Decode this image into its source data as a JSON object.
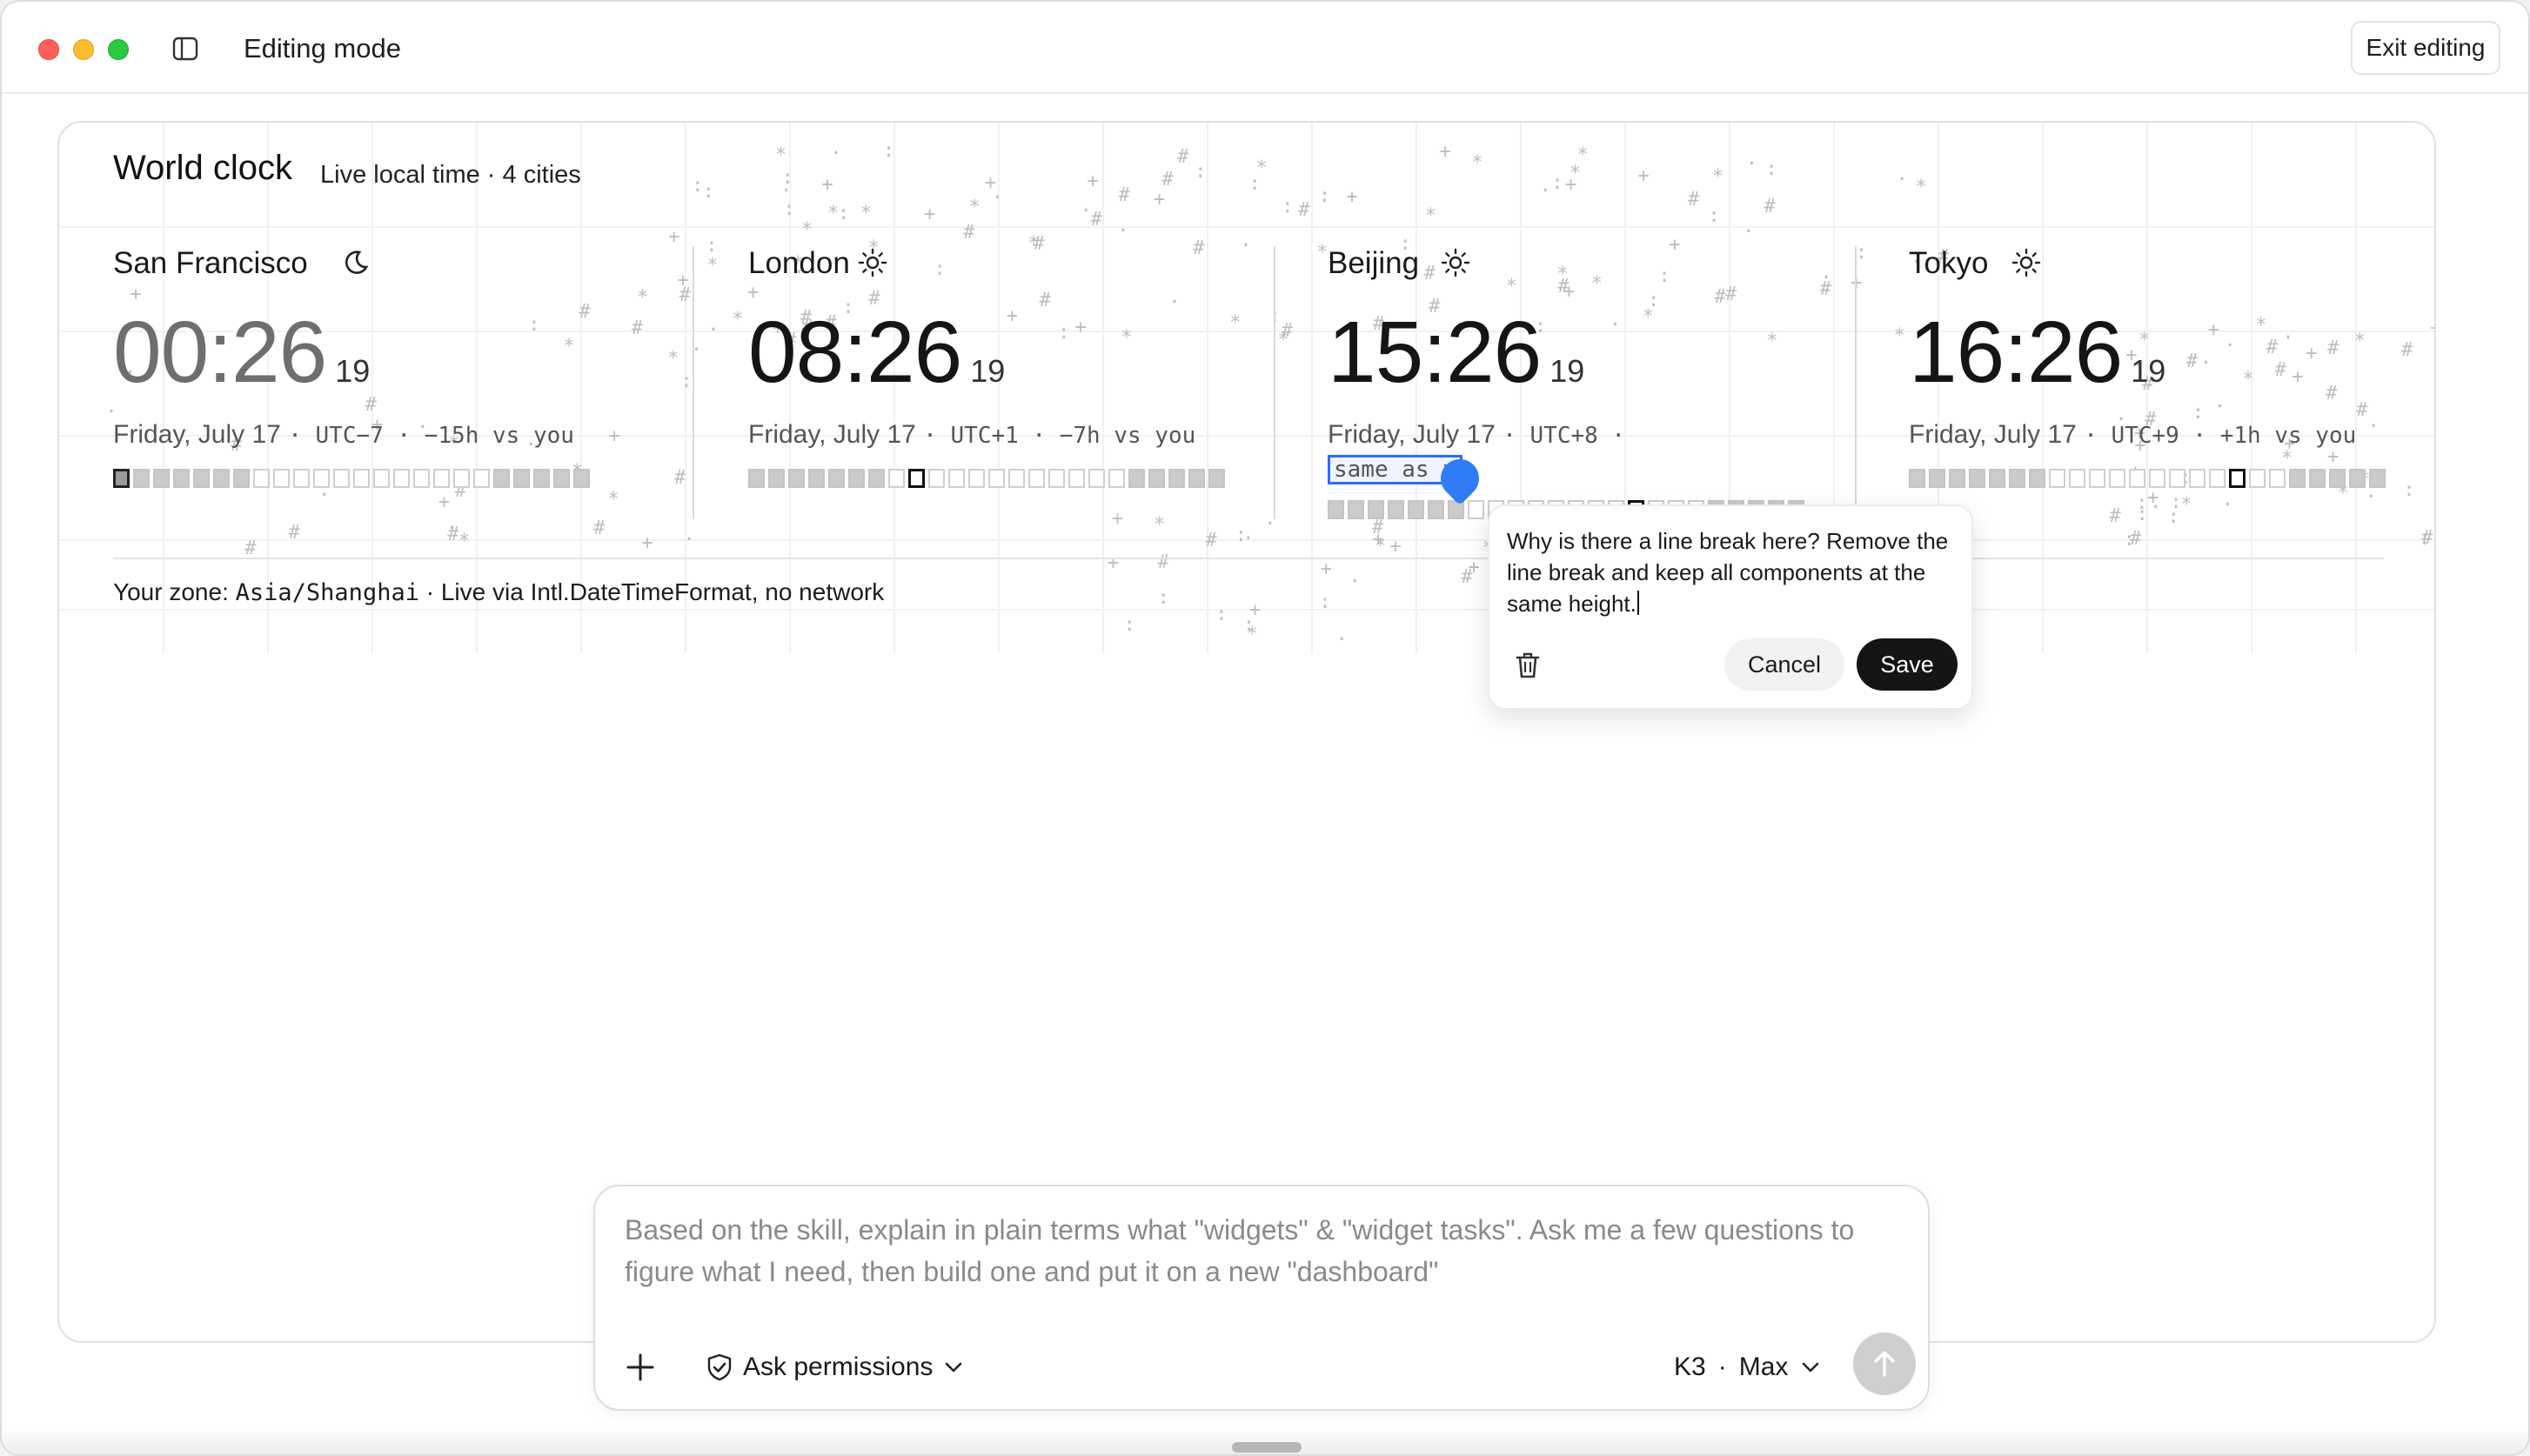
{
  "window": {
    "mode_title": "Editing mode",
    "exit_label": "Exit editing"
  },
  "widget": {
    "title": "World clock",
    "subtitle": "Live local time · 4 cities",
    "cities": [
      {
        "name": "San Francisco",
        "icon": "moon-icon",
        "time": "00:26",
        "seconds": "19",
        "date": "Friday, July 17",
        "meta": "· UTC−7 · −15h vs you",
        "current_hour": 0
      },
      {
        "name": "London",
        "icon": "sun-icon",
        "time": "08:26",
        "seconds": "19",
        "date": "Friday, July 17",
        "meta": "· UTC+1 · −7h vs you",
        "current_hour": 8
      },
      {
        "name": "Beijing",
        "icon": "sun-icon",
        "time": "15:26",
        "seconds": "19",
        "date": "Friday, July 17",
        "meta": "· UTC+8 ·",
        "selected_text": "same as y",
        "current_hour": 15
      },
      {
        "name": "Tokyo",
        "icon": "sun-icon",
        "time": "16:26",
        "seconds": "19",
        "date": "Friday, July 17",
        "meta": "· UTC+9 · +1h vs you",
        "current_hour": 16
      }
    ],
    "zone_prefix": "Your zone:",
    "zone_value": "Asia/Shanghai",
    "zone_suffix": "· Live via Intl.DateTimeFormat, no network"
  },
  "popover": {
    "comment": "Why is there a line break here? Remove the line break and keep all components at the same height.",
    "cancel_label": "Cancel",
    "save_label": "Save"
  },
  "composer": {
    "prompt": "Based on the skill, explain in plain terms what \"widgets\" & \"widget tasks\". Ask me a few questions to figure what I need, then build one and put it on a new \"dashboard\"",
    "permissions_label": "Ask permissions",
    "model_label": "K3",
    "effort_label": "Max"
  }
}
